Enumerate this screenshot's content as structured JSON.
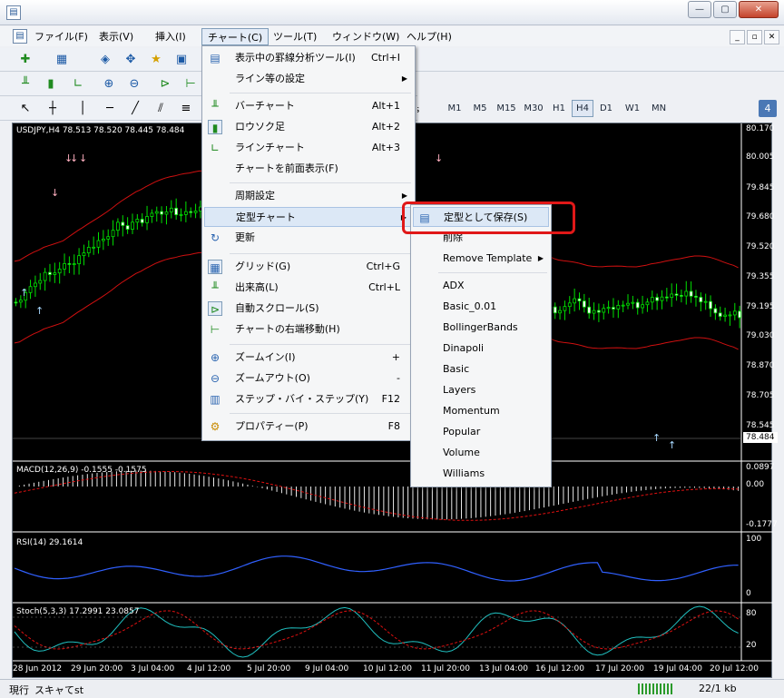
{
  "window": {
    "icon": "mt4-icon",
    "buttons": {
      "minimize": "—",
      "maximize": "▢",
      "close": "✕"
    }
  },
  "menubar": {
    "items": [
      "ファイル(F)",
      "表示(V)",
      "挿入(I)",
      "チャート(C)",
      "ツール(T)",
      "ウィンドウ(W)",
      "ヘルプ(H)"
    ],
    "mdi": [
      "_",
      "▫",
      "✕"
    ]
  },
  "timeframes": [
    "M1",
    "M5",
    "M15",
    "M30",
    "H1",
    "H4",
    "D1",
    "W1",
    "MN"
  ],
  "timeframe_selected": "H4",
  "partial_toolbar_text": "rs",
  "notify_badge": "4",
  "chart": {
    "main_label": "USDJPY,H4  78.513 78.520 78.445 78.484",
    "price_axis": [
      "80.170",
      "80.005",
      "79.845",
      "79.680",
      "79.520",
      "79.355",
      "79.195",
      "79.030",
      "78.870",
      "78.705",
      "78.545"
    ],
    "current_price": "78.484",
    "macd_label": "MACD(12,26,9) -0.1555 -0.1575",
    "macd_axis": [
      "0.0897",
      "0.00",
      "-0.1777"
    ],
    "rsi_label": "RSI(14) 29.1614",
    "rsi_axis": [
      "100",
      "0"
    ],
    "stoch_label": "Stoch(5,3,3) 17.2991 23.0857",
    "stoch_axis": [
      "80",
      "20"
    ],
    "time_axis": [
      "28 Jun 2012",
      "29 Jun 20:00",
      "3 Jul 04:00",
      "4 Jul 12:00",
      "5 Jul 20:00",
      "9 Jul 04:00",
      "10 Jul 12:00",
      "11 Jul 20:00",
      "13 Jul 04:00",
      "16 Jul 12:00",
      "17 Jul 20:00",
      "19 Jul 04:00",
      "20 Jul 12:00"
    ]
  },
  "chart_menu": {
    "items": [
      {
        "label": "表示中の罫線分析ツール(I)",
        "shortcut": "Ctrl+I",
        "icon": "objects-list-icon"
      },
      {
        "label": "ライン等の設定",
        "submenu": true
      },
      {
        "label": "バーチャート",
        "shortcut": "Alt+1",
        "icon": "bar-chart-icon"
      },
      {
        "label": "ロウソク足",
        "shortcut": "Alt+2",
        "icon": "candlestick-icon"
      },
      {
        "label": "ラインチャート",
        "shortcut": "Alt+3",
        "icon": "line-chart-icon"
      },
      {
        "label": "チャートを前面表示(F)"
      },
      {
        "label": "周期設定",
        "submenu": true
      },
      {
        "label": "定型チャート",
        "submenu": true
      },
      {
        "label": "更新",
        "icon": "refresh-icon"
      },
      {
        "label": "グリッド(G)",
        "shortcut": "Ctrl+G",
        "icon": "grid-icon"
      },
      {
        "label": "出来高(L)",
        "shortcut": "Ctrl+L",
        "icon": "volume-icon"
      },
      {
        "label": "自動スクロール(S)",
        "icon": "autoscroll-icon"
      },
      {
        "label": "チャートの右端移動(H)",
        "icon": "shift-icon"
      },
      {
        "label": "ズームイン(I)",
        "shortcut": "+",
        "icon": "zoom-in-icon"
      },
      {
        "label": "ズームアウト(O)",
        "shortcut": "-",
        "icon": "zoom-out-icon"
      },
      {
        "label": "ステップ・バイ・ステップ(Y)",
        "shortcut": "F12",
        "icon": "step-icon"
      },
      {
        "label": "プロパティー(P)",
        "shortcut": "F8",
        "icon": "properties-icon"
      }
    ]
  },
  "template_submenu": {
    "save": "定型として保存(S)",
    "delete": "削除",
    "remove": "Remove Template",
    "templates": [
      "ADX",
      "Basic_0.01",
      "BollingerBands",
      "Dinapoli",
      "Basic",
      "Layers",
      "Momentum",
      "Popular",
      "Volume",
      "Williams"
    ]
  },
  "status": {
    "left": "現行",
    "profile": "スキャてst",
    "right": "22/1 kb"
  }
}
